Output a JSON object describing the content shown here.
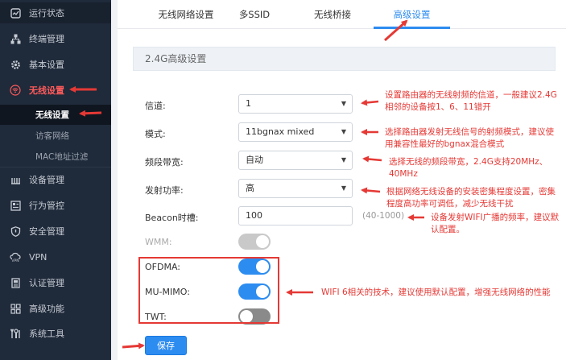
{
  "sidebar": {
    "items": [
      {
        "label": "运行状态",
        "icon": "dashboard-icon"
      },
      {
        "label": "终端管理",
        "icon": "network-icon"
      },
      {
        "label": "基本设置",
        "icon": "gear-icon"
      },
      {
        "label": "无线设置",
        "icon": "wifi-icon"
      },
      {
        "label": "设备管理",
        "icon": "device-icon"
      },
      {
        "label": "行为管控",
        "icon": "behavior-icon"
      },
      {
        "label": "安全管理",
        "icon": "shield-icon"
      },
      {
        "label": "VPN",
        "icon": "vpn-icon"
      },
      {
        "label": "认证管理",
        "icon": "auth-icon"
      },
      {
        "label": "高级功能",
        "icon": "grid-icon"
      },
      {
        "label": "系统工具",
        "icon": "tools-icon"
      }
    ],
    "subitems": [
      "无线设置",
      "访客网络",
      "MAC地址过滤"
    ]
  },
  "tabs": [
    "无线网络设置",
    "多SSID",
    "无线桥接",
    "高级设置"
  ],
  "section_title": "2.4G高级设置",
  "form": {
    "channel": {
      "label": "信道:",
      "value": "1"
    },
    "mode": {
      "label": "模式:",
      "value": "11bgnax mixed"
    },
    "bandwidth": {
      "label": "频段带宽:",
      "value": "自动"
    },
    "power": {
      "label": "发射功率:",
      "value": "高"
    },
    "beacon": {
      "label": "Beacon时槽:",
      "value": "100",
      "range": "(40-1000)"
    },
    "wmm": {
      "label": "WMM:"
    },
    "ofdma": {
      "label": "OFDMA:"
    },
    "mumimo": {
      "label": "MU-MIMO:"
    },
    "twt": {
      "label": "TWT:"
    }
  },
  "save_label": "保存",
  "notes": {
    "channel": [
      "设置路由器的无线射频的信道，一般建议2.4G",
      "相邻的设备按1、6、11错开"
    ],
    "mode": [
      "选择路由器发射无线信号的射频模式，建议使",
      "用兼容性最好的bgnax混合模式"
    ],
    "bandwidth": [
      "选择无线的频段带宽，2.4G支持20MHz、",
      "40MHz"
    ],
    "power": [
      "根据网络无线设备的安装密集程度设置，密集",
      "程度高功率可调低，减少无线干扰"
    ],
    "beacon": [
      "设备发射WIFI广播的频率，建议默",
      "认配置。"
    ],
    "wifi6": "WIFI 6相关的技术，建议使用默认配置，增强无线网络的性能"
  },
  "colors": {
    "accent": "#2d8cf0",
    "annotation": "#e53935",
    "sidebar_bg": "#1f2a3a"
  }
}
